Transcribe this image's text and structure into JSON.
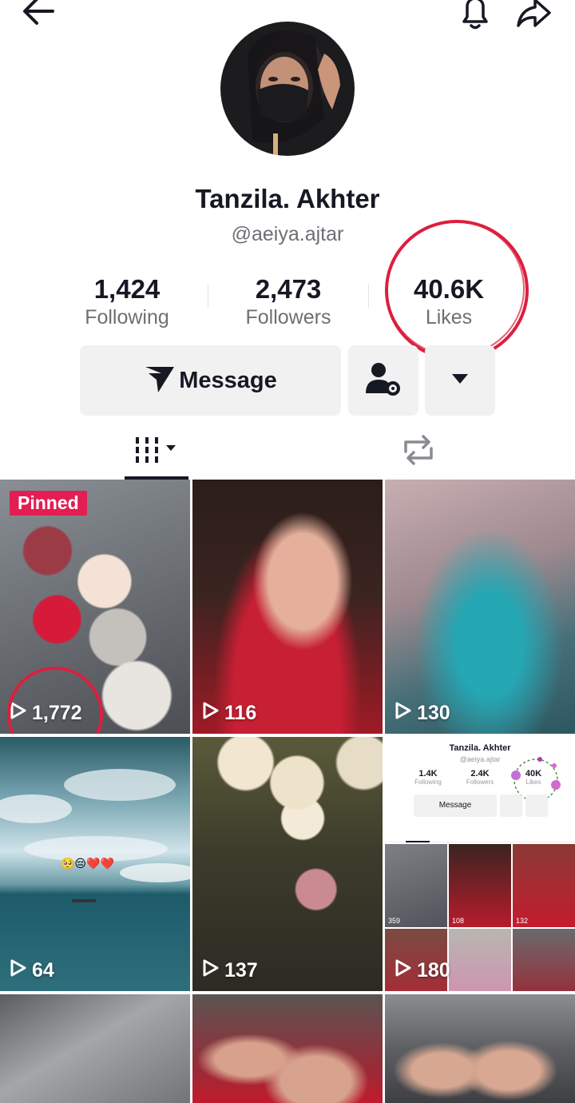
{
  "profile": {
    "name": "Tanzila. Akhter",
    "handle": "@aeiya.ajtar"
  },
  "stats": {
    "following": {
      "value": "1,424",
      "label": "Following"
    },
    "followers": {
      "value": "2,473",
      "label": "Followers"
    },
    "likes": {
      "value": "40.6K",
      "label": "Likes"
    }
  },
  "actions": {
    "message_label": "Message"
  },
  "colors": {
    "accent": "#e31e52",
    "annotation": "#dc1f3f",
    "button_bg": "#f1f1f2"
  },
  "icons": {
    "back": "back-arrow-icon",
    "notifications": "bell-icon",
    "share": "share-icon",
    "message": "send-icon",
    "follow_settings": "user-settings-icon",
    "more": "caret-down-icon",
    "videos_tab": "video-grid-icon",
    "reposts_tab": "repost-icon",
    "play": "play-icon"
  },
  "videos": [
    {
      "views": "1,772",
      "pinned_label": "Pinned"
    },
    {
      "views": "116"
    },
    {
      "views": "130"
    },
    {
      "views": "64"
    },
    {
      "views": "137"
    },
    {
      "views": "180"
    }
  ],
  "embedded_screenshot": {
    "name": "Tanzila. Akhter",
    "handle": "@aeiya.ajtar",
    "following": {
      "value": "1.4K",
      "label": "Following"
    },
    "followers": {
      "value": "2.4K",
      "label": "Followers"
    },
    "likes": {
      "value": "40K",
      "label": "Likes"
    },
    "message_label": "Message",
    "thumb_views": [
      "359",
      "108",
      "132"
    ]
  }
}
